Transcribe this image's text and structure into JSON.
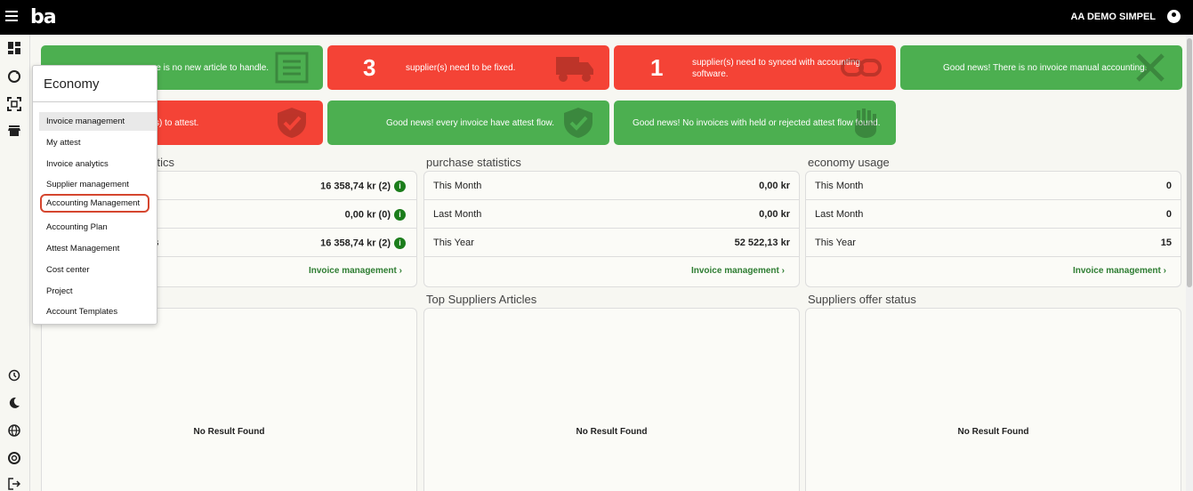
{
  "header": {
    "logo": "ba",
    "company": "AA DEMO SIMPEL"
  },
  "cards_row1": [
    {
      "number": "",
      "text": "Good news! There is no new article to handle.",
      "visible_text": "re is no new article to handle.",
      "color": "green"
    },
    {
      "number": "3",
      "text": "supplier(s) need to be fixed.",
      "color": "red"
    },
    {
      "number": "1",
      "text": "supplier(s) need to synced with accounting software.",
      "color": "red"
    },
    {
      "number": "",
      "text": "Good news! There is no invoice manual accounting.",
      "color": "green"
    }
  ],
  "cards_row2": [
    {
      "text": "s) to attest.",
      "color": "red"
    },
    {
      "text": "Good news! every invoice have attest flow.",
      "color": "green"
    },
    {
      "text": "Good news! No invoices with held or rejected attest flow found.",
      "color": "green"
    }
  ],
  "invoice_stats": {
    "title": "stics",
    "rows": [
      {
        "value": "16 358,74 kr (2)"
      },
      {
        "value": "0,00 kr (0)"
      },
      {
        "label": "s",
        "value": "16 358,74 kr (2)"
      }
    ],
    "link": "Invoice management"
  },
  "purchase_stats": {
    "title": "purchase statistics",
    "rows": [
      {
        "label": "This Month",
        "value": "0,00 kr"
      },
      {
        "label": "Last Month",
        "value": "0,00 kr"
      },
      {
        "label": "This Year",
        "value": "52 522,13 kr"
      }
    ],
    "link": "Invoice management"
  },
  "economy_usage": {
    "title": "economy usage",
    "rows": [
      {
        "label": "This Month",
        "value": "0"
      },
      {
        "label": "Last Month",
        "value": "0"
      },
      {
        "label": "This Year",
        "value": "15"
      }
    ],
    "link": "Invoice management"
  },
  "bottom_panels": [
    {
      "title": "",
      "empty": "No Result Found"
    },
    {
      "title": "Top Suppliers Articles",
      "empty": "No Result Found"
    },
    {
      "title": "Suppliers offer status",
      "empty": "No Result Found"
    }
  ],
  "dropdown": {
    "title": "Economy",
    "items": [
      "Invoice management",
      "My attest",
      "Invoice analytics",
      "Supplier management",
      "Accounting Management",
      "Accounting Plan",
      "Attest Management",
      "Cost center",
      "Project",
      "Account Templates"
    ]
  },
  "colors": {
    "green": "#4caf50",
    "red": "#f44336",
    "highlight": "#d5462f",
    "topbar": "#000000"
  },
  "icons": [
    "menu-icon",
    "dashboard-icon",
    "sync-icon",
    "scan-icon",
    "store-icon",
    "history-icon",
    "moon-icon",
    "globe-icon",
    "support-icon",
    "logout-icon",
    "user-icon",
    "info-icon",
    "chevron-right-icon"
  ]
}
